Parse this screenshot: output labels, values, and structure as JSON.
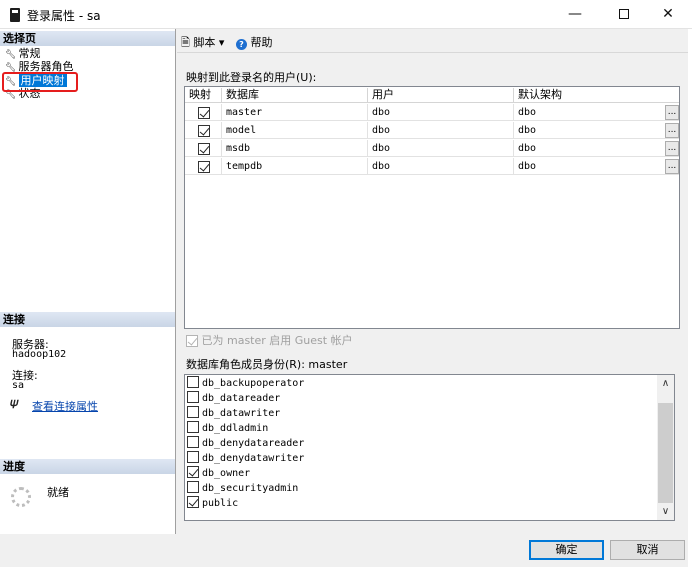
{
  "window": {
    "title": "登录属性 - sa",
    "min_glyph": "—",
    "close_glyph": "✕"
  },
  "left": {
    "select_page_header": "选择页",
    "pages": [
      {
        "label": "常规",
        "icon": "wrench-icon"
      },
      {
        "label": "服务器角色",
        "icon": "wrench-icon"
      },
      {
        "label": "用户映射",
        "icon": "wrench-icon",
        "selected": true
      },
      {
        "label": "状态",
        "icon": "wrench-icon"
      }
    ],
    "connection_header": "连接",
    "server_label": "服务器:",
    "server_value": "hadoop102",
    "connection_label": "连接:",
    "connection_value": "sa",
    "view_conn_props": "查看连接属性",
    "progress_header": "进度",
    "progress_status": "就绪"
  },
  "toolbar": {
    "script_label": "脚本",
    "dropdown_glyph": "▾",
    "help_label": "帮助"
  },
  "mapping": {
    "label": "映射到此登录名的用户(U):",
    "columns": [
      "映射",
      "数据库",
      "用户",
      "默认架构"
    ],
    "rows": [
      {
        "mapped": true,
        "database": "master",
        "user": "dbo",
        "schema": "dbo"
      },
      {
        "mapped": true,
        "database": "model",
        "user": "dbo",
        "schema": "dbo"
      },
      {
        "mapped": true,
        "database": "msdb",
        "user": "dbo",
        "schema": "dbo"
      },
      {
        "mapped": true,
        "database": "tempdb",
        "user": "dbo",
        "schema": "dbo"
      }
    ],
    "ellipsis": "..."
  },
  "guest_label": "已为 master 启用 Guest 帐户",
  "roles": {
    "label": "数据库角色成员身份(R): master",
    "items": [
      {
        "name": "db_backupoperator",
        "checked": false
      },
      {
        "name": "db_datareader",
        "checked": false
      },
      {
        "name": "db_datawriter",
        "checked": false
      },
      {
        "name": "db_ddladmin",
        "checked": false
      },
      {
        "name": "db_denydatareader",
        "checked": false
      },
      {
        "name": "db_denydatawriter",
        "checked": false
      },
      {
        "name": "db_owner",
        "checked": true
      },
      {
        "name": "db_securityadmin",
        "checked": false
      },
      {
        "name": "public",
        "checked": true
      }
    ]
  },
  "buttons": {
    "ok": "确定",
    "cancel": "取消"
  }
}
